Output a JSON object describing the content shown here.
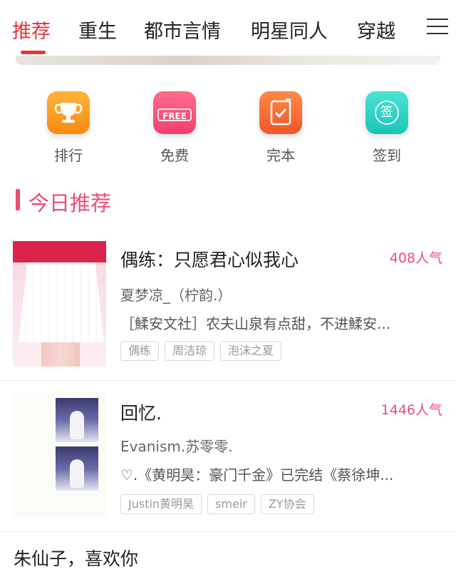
{
  "tabs": [
    {
      "label": "推荐",
      "active": true
    },
    {
      "label": "重生",
      "active": false
    },
    {
      "label": "都市言情",
      "active": false
    },
    {
      "label": "明星同人",
      "active": false
    },
    {
      "label": "穿越",
      "active": false
    }
  ],
  "menu_icon": "hamburger-menu-icon",
  "entries": [
    {
      "label": "排行",
      "icon": "trophy-icon",
      "color": "#f78a12"
    },
    {
      "label": "免费",
      "icon": "free-tag-icon",
      "badge": "FREE",
      "color": "#f23f6b"
    },
    {
      "label": "完本",
      "icon": "checkmark-book-icon",
      "color": "#f1562a"
    },
    {
      "label": "签到",
      "icon": "sign-in-icon",
      "badge": "签",
      "color": "#1cc4b6"
    }
  ],
  "section": {
    "title": "今日推荐",
    "accent": "#f04a73"
  },
  "books": [
    {
      "title": "偶练：只愿君心似我心",
      "popularity": "408人气",
      "author": "夏梦凉_（柠韵.）",
      "description": "［鰇安文社］农夫山泉有点甜，不进鰇安...",
      "tags": [
        "偶练",
        "周洁琼",
        "泡沫之夏"
      ]
    },
    {
      "title": "回忆.",
      "popularity": "1446人气",
      "author": "Evanism.苏零零.",
      "description": "♡.《黄明昊：豪门千金》已完结《蔡徐坤...",
      "tags": [
        "Justin黄明昊",
        "smeir",
        "ZY协会"
      ]
    }
  ],
  "next_book_title": "朱仙子，喜欢你"
}
